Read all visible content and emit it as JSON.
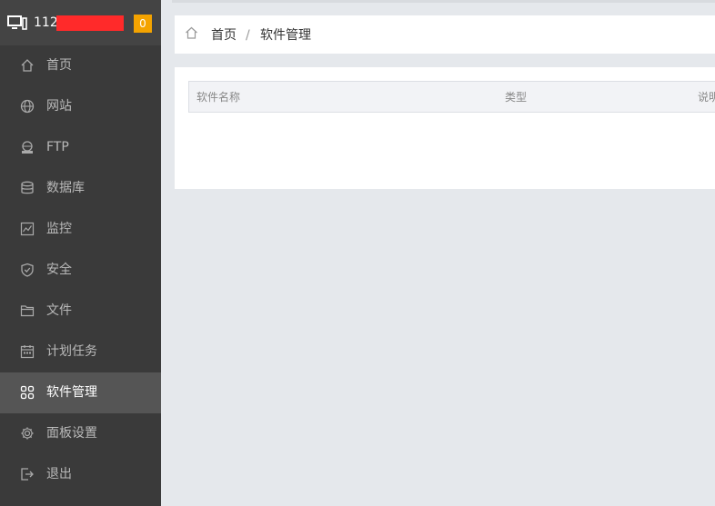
{
  "server": {
    "ip_prefix": "112",
    "badge_count": "0",
    "colors": {
      "badge": "#f4a300",
      "redaction": "#ff2a2a"
    }
  },
  "sidebar": {
    "items": [
      {
        "label": "首页",
        "icon": "home-icon"
      },
      {
        "label": "网站",
        "icon": "globe-icon"
      },
      {
        "label": "FTP",
        "icon": "ftp-icon"
      },
      {
        "label": "数据库",
        "icon": "database-icon"
      },
      {
        "label": "监控",
        "icon": "monitor-chart-icon"
      },
      {
        "label": "安全",
        "icon": "shield-icon"
      },
      {
        "label": "文件",
        "icon": "folder-icon"
      },
      {
        "label": "计划任务",
        "icon": "calendar-icon"
      },
      {
        "label": "软件管理",
        "icon": "grid-apps-icon",
        "active": true
      },
      {
        "label": "面板设置",
        "icon": "gear-icon"
      },
      {
        "label": "退出",
        "icon": "logout-icon"
      }
    ]
  },
  "breadcrumb": {
    "home": "首页",
    "separator": "/",
    "current": "软件管理"
  },
  "table": {
    "columns": [
      "软件名称",
      "类型",
      "说明"
    ]
  }
}
